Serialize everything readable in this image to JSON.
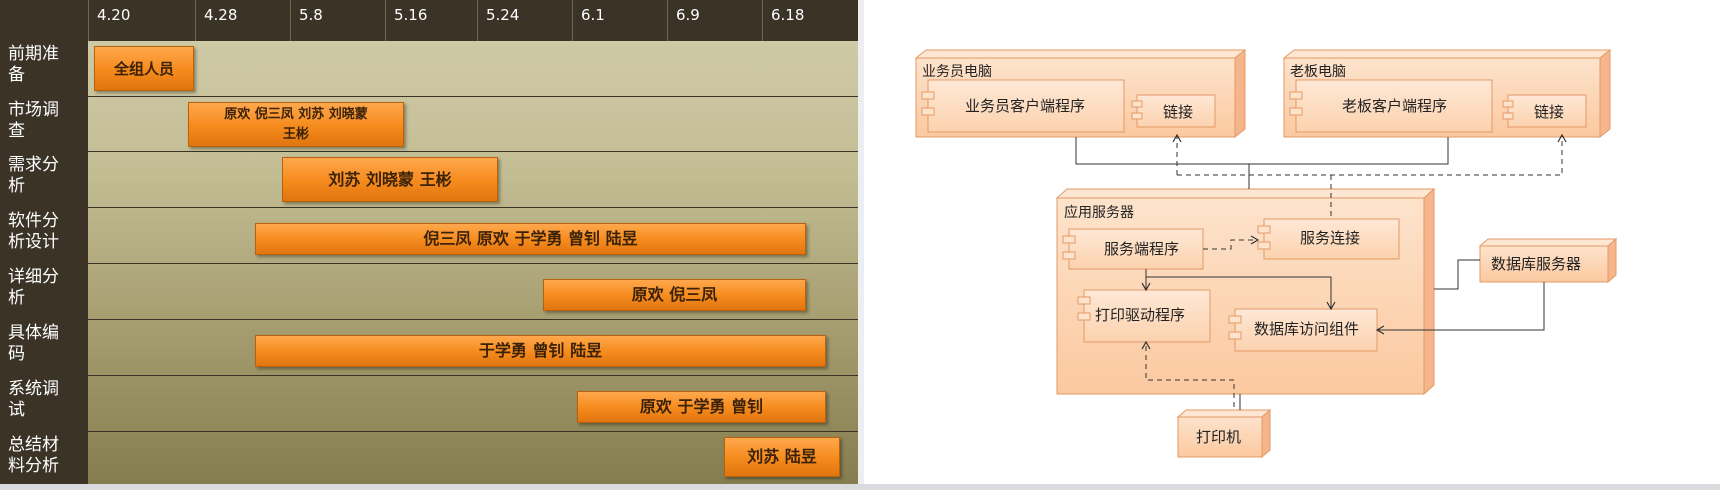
{
  "gantt": {
    "dates": [
      "4.20",
      "4.28",
      "5.8",
      "5.16",
      "5.24",
      "6.1",
      "6.9",
      "6.18"
    ],
    "tasks": [
      {
        "label": "前期准\n备",
        "bar_text": "全组人员"
      },
      {
        "label": "市场调\n查",
        "bar_text": "原欢 倪三凤 刘苏 刘晓蒙\n王彬"
      },
      {
        "label": "需求分\n析",
        "bar_text": "刘苏 刘晓蒙 王彬"
      },
      {
        "label": "软件分\n析设计",
        "bar_text": "倪三凤 原欢 于学勇 曾钊 陆昱"
      },
      {
        "label": "详细分\n析",
        "bar_text": "原欢 倪三凤"
      },
      {
        "label": "具体编\n码",
        "bar_text": "于学勇 曾钊 陆昱"
      },
      {
        "label": "系统调\n试",
        "bar_text": "原欢 于学勇 曾钊"
      },
      {
        "label": "总结材\n料分析",
        "bar_text": "刘苏 陆昱"
      }
    ]
  },
  "diagram": {
    "nodes": {
      "salesman_pc": "业务员电脑",
      "boss_pc": "老板电脑",
      "app_server": "应用服务器",
      "db_server": "数据库服务器",
      "printer": "打印机"
    },
    "components": {
      "salesman_client": "业务员客户端程序",
      "salesman_link": "链接",
      "boss_client": "老板客户端程序",
      "boss_link": "链接",
      "server_program": "服务端程序",
      "service_connection": "服务连接",
      "print_driver": "打印驱动程序",
      "db_access": "数据库访问组件"
    },
    "colors": {
      "node_fill": "#fcd5b4",
      "node_side": "#f6b58a",
      "node_stroke": "#e39a66"
    }
  }
}
